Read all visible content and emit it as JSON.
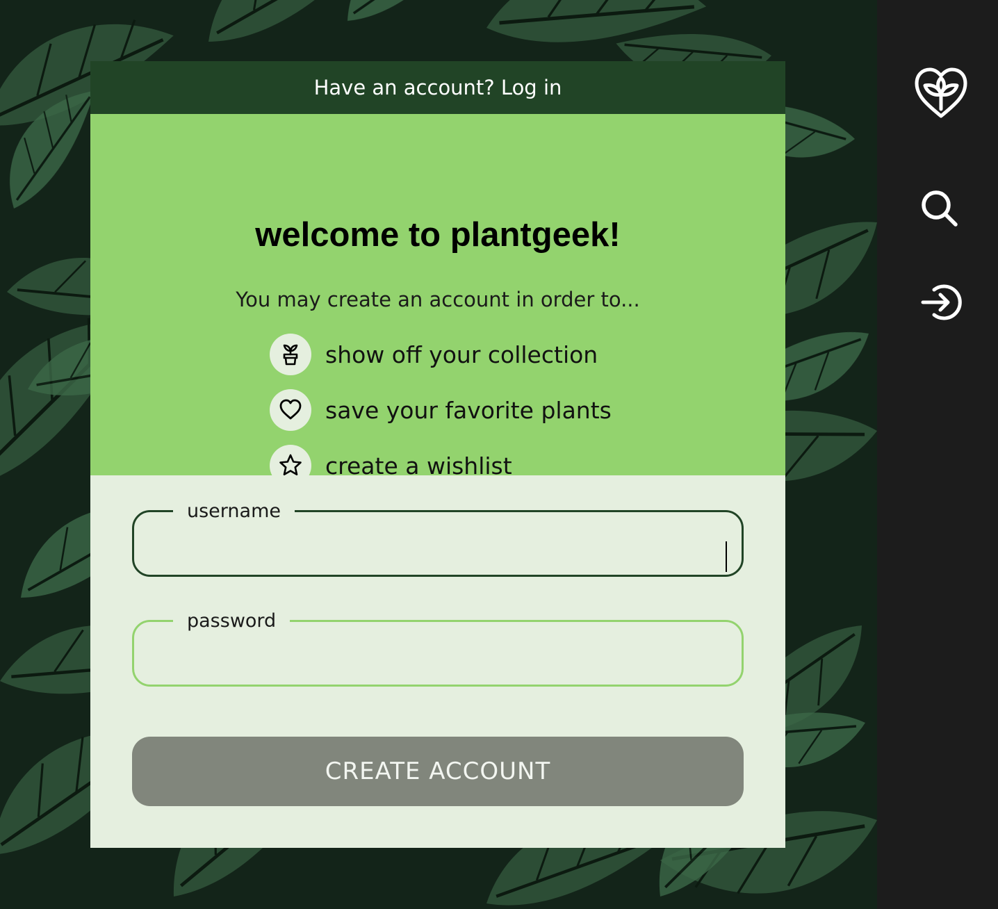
{
  "header": {
    "login_prompt": "Have an account? Log in"
  },
  "intro": {
    "title": "welcome to plantgeek!",
    "subtitle": "You may create an account in order to...",
    "benefits": [
      {
        "icon": "potted-plant-icon",
        "label": "show off your collection"
      },
      {
        "icon": "heart-icon",
        "label": "save your favorite plants"
      },
      {
        "icon": "star-icon",
        "label": "create a wishlist"
      }
    ]
  },
  "form": {
    "username_label": "username",
    "username_value": "",
    "password_label": "password",
    "password_value": "",
    "submit_label": "CREATE ACCOUNT"
  },
  "nav": {
    "icons": [
      "plantgeek-logo-icon",
      "search-icon",
      "login-icon"
    ]
  },
  "colors": {
    "header_green": "#214426",
    "light_green": "#93d36e",
    "card_bg": "#e5efdf",
    "button_gray": "#81867c",
    "rail_bg": "#1c1c1c"
  }
}
